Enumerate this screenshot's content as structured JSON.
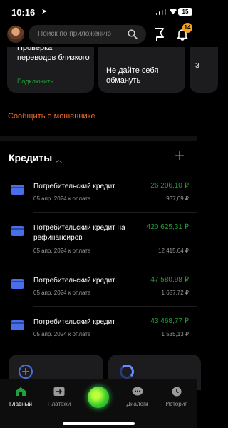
{
  "status_bar": {
    "time": "10:16",
    "battery": "15"
  },
  "search": {
    "placeholder": "Поиск по приложению"
  },
  "notifications": {
    "badge": "14"
  },
  "promos": [
    {
      "text": "Проверка переводов близкого",
      "link": "Подключить"
    },
    {
      "text": "Не дайте себя обмануть"
    },
    {
      "text": "З"
    }
  ],
  "report_link": "Сообщить о мошеннике",
  "credits_section": {
    "title": "Кредиты",
    "items": [
      {
        "name": "Потребительский кредит",
        "date": "05 апр. 2024 к оплате",
        "amount": "26 206,10 ₽",
        "payment": "937,09 ₽"
      },
      {
        "name": "Потребительский кредит на рефинансиров",
        "date": "05 апр. 2024 к оплате",
        "amount": "420 625,31 ₽",
        "payment": "12 415,64 ₽"
      },
      {
        "name": "Потребительский кредит",
        "date": "05 апр. 2024 к оплате",
        "amount": "47 580,98 ₽",
        "payment": "1 687,72 ₽"
      },
      {
        "name": "Потребительский кредит",
        "date": "05 апр. 2024 к оплате",
        "amount": "43 468,77 ₽",
        "payment": "1 535,13 ₽"
      }
    ]
  },
  "tabbar": {
    "tabs": [
      {
        "label": "Главный",
        "icon": "home-icon"
      },
      {
        "label": "Платежи",
        "icon": "payments-icon"
      },
      {
        "label": "",
        "icon": "assistant-orb-icon"
      },
      {
        "label": "Диалоги",
        "icon": "chat-icon"
      },
      {
        "label": "История",
        "icon": "clock-icon"
      }
    ]
  },
  "colors": {
    "accent_green": "#21a038",
    "warning_orange": "#ef6c2f",
    "card_blue": "#4a6ee8",
    "badge_orange": "#f4a321"
  }
}
